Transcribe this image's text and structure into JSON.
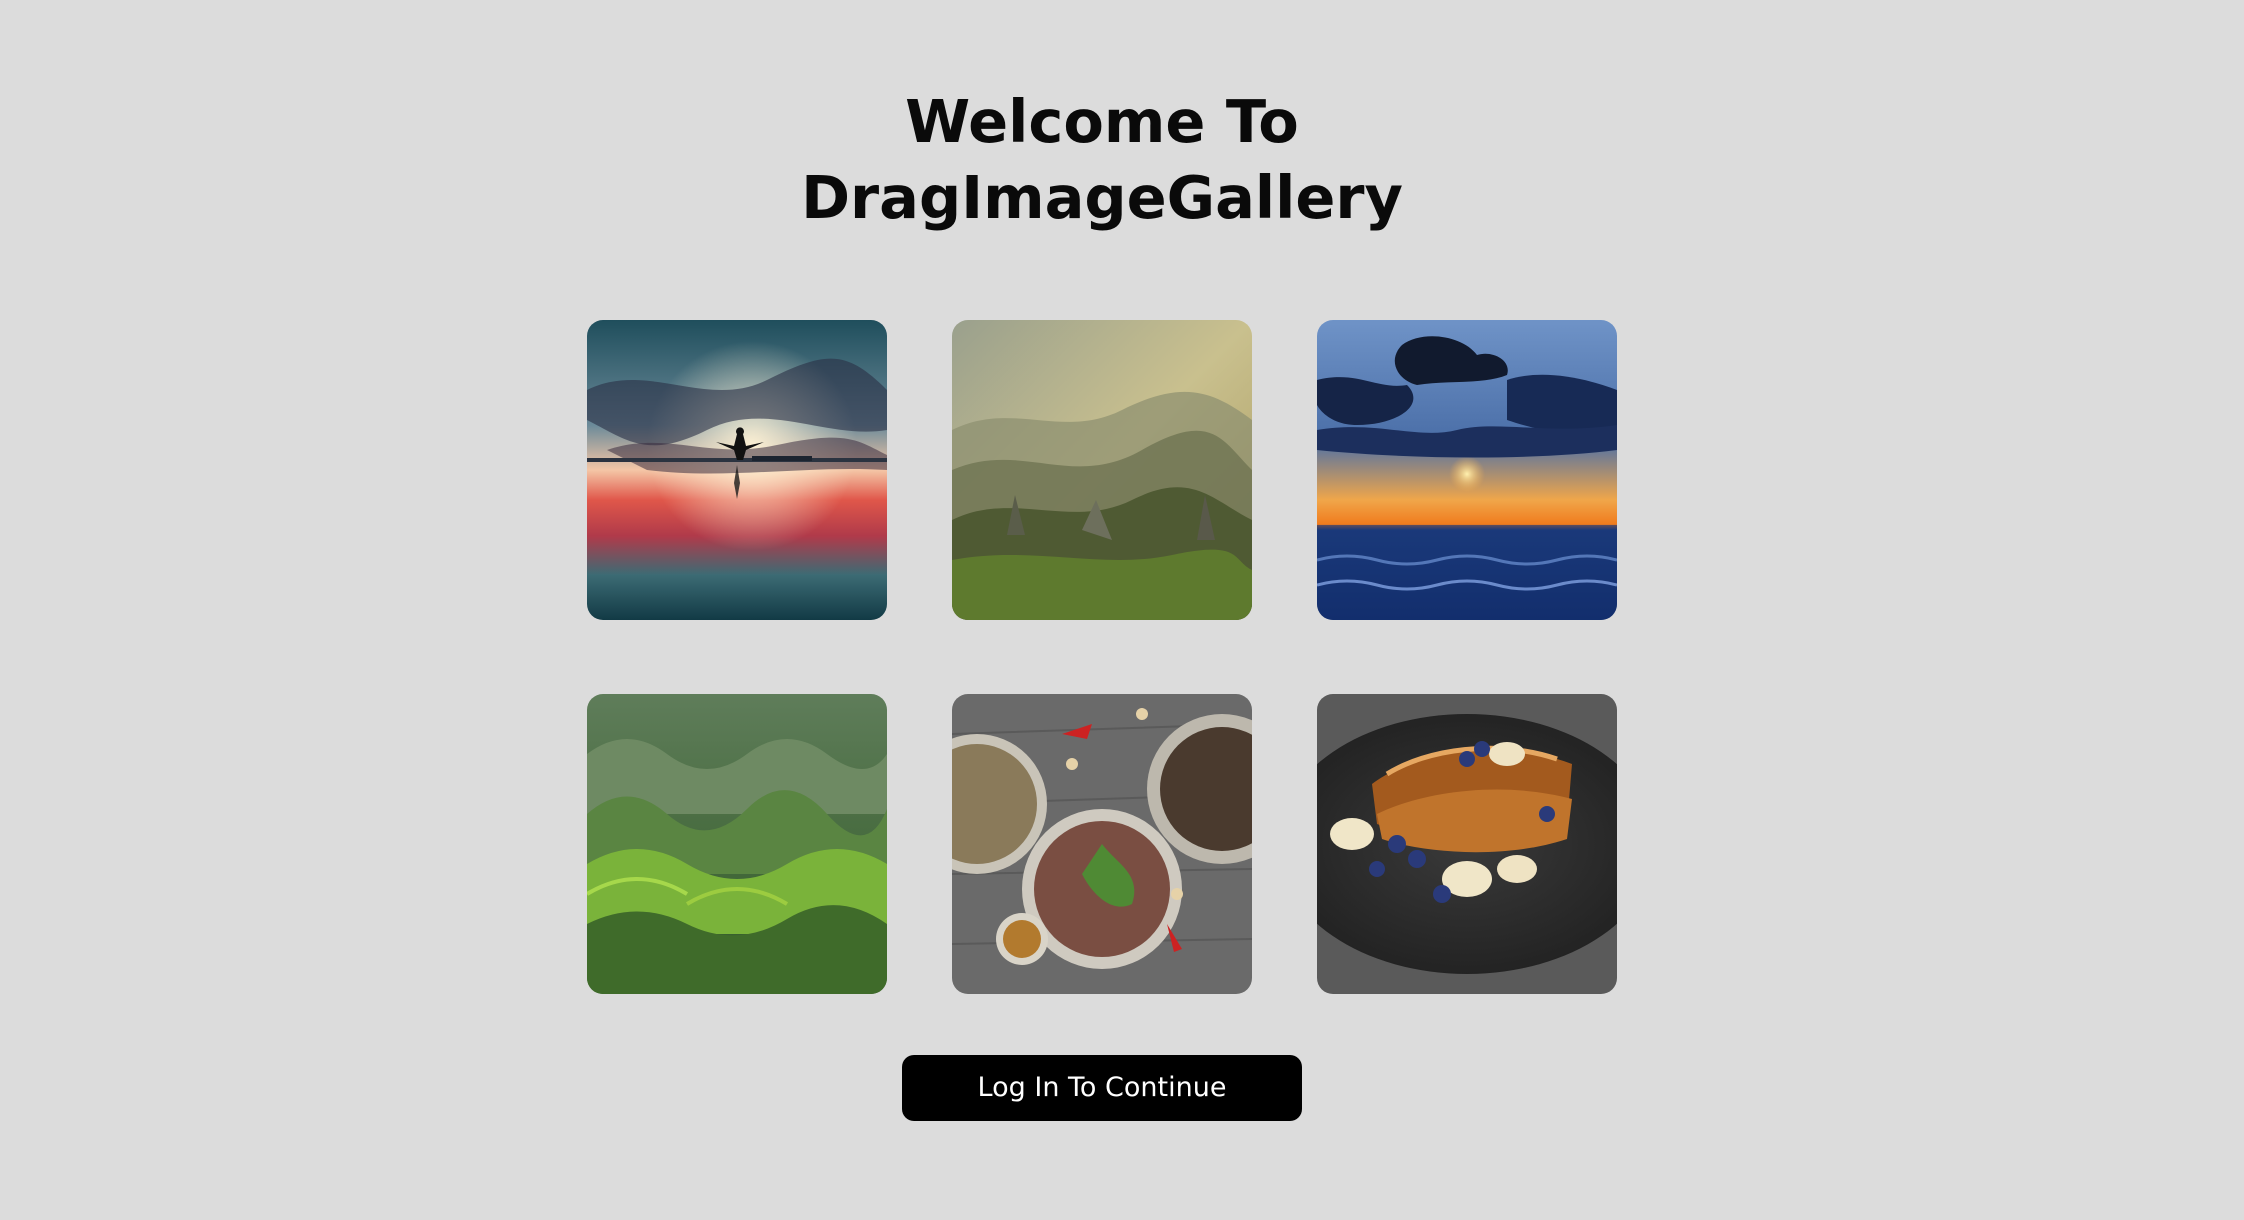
{
  "header": {
    "title_line1": "Welcome To",
    "title_line2": "DragImageGallery"
  },
  "gallery": {
    "images": [
      {
        "subject": "person silhouette at sunset reflected on water"
      },
      {
        "subject": "misty mountain valley with rock spires"
      },
      {
        "subject": "orange sunset over dark blue ocean with clouds"
      },
      {
        "subject": "green rolling ridged hills"
      },
      {
        "subject": "plates of salads and steak on wooden table"
      },
      {
        "subject": "french toast with bananas and blueberries"
      }
    ]
  },
  "actions": {
    "login_label": "Log In To Continue"
  },
  "colors": {
    "background": "#dcdcdc",
    "button_bg": "#000000",
    "button_text": "#ffffff",
    "title_text": "#0a0a0a"
  }
}
